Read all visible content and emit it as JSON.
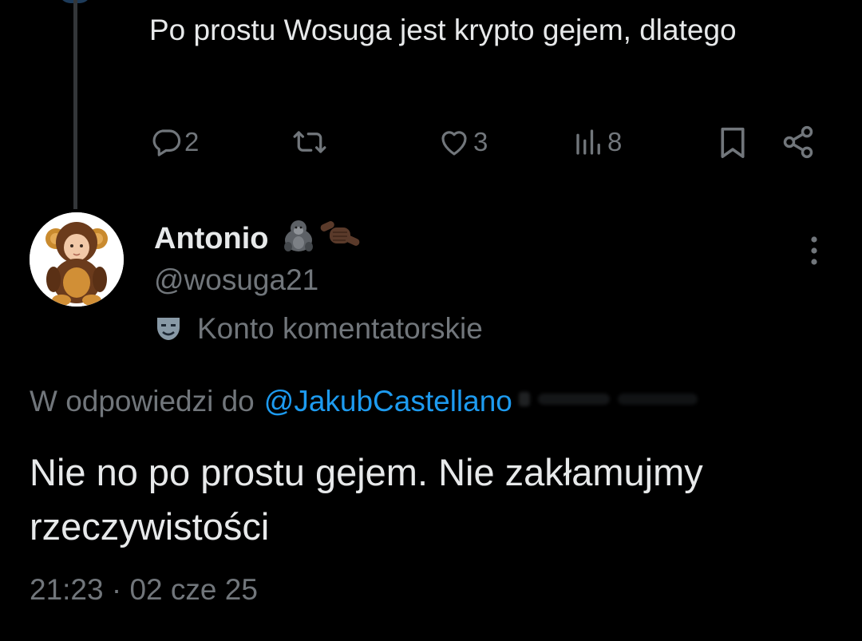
{
  "parent_tweet": {
    "text": "Po prostu Wosuga jest krypto gejem, dlatego",
    "actions": {
      "reply_count": "2",
      "retweet_count": "",
      "like_count": "3",
      "views_count": "8"
    },
    "icons": [
      "reply-icon",
      "retweet-icon",
      "like-icon",
      "views-icon",
      "bookmark-icon",
      "share-icon"
    ]
  },
  "tweet": {
    "display_name": "Antonio",
    "name_emojis": [
      "gorilla-emoji",
      "call-me-hand-emoji"
    ],
    "handle": "@wosuga21",
    "account_label": "Konto komentatorskie",
    "account_label_icon": "performing-arts-mask-icon",
    "reply_prefix": "W odpowiedzi do",
    "reply_mention": "@JakubCastellano",
    "text": "Nie no po prostu gejem. Nie zakłamujmy rzeczywistości",
    "timestamp": "21:23 · 02 cze 25"
  },
  "colors": {
    "background": "#000000",
    "primary_text": "#e7e9ea",
    "secondary_text": "#71767b",
    "accent": "#1d9bf0",
    "thread_line": "#333639"
  }
}
